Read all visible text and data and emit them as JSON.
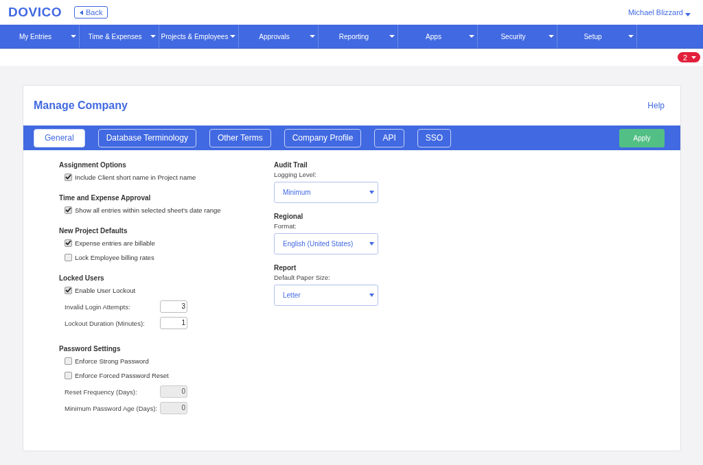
{
  "header": {
    "logo": "DOVICO",
    "back_button": "Back",
    "user": "Michael Blizzard"
  },
  "nav": [
    {
      "label": "My Entries"
    },
    {
      "label": "Time & Expenses"
    },
    {
      "label": "Projects & Employees"
    },
    {
      "label": "Approvals"
    },
    {
      "label": "Reporting"
    },
    {
      "label": "Apps"
    },
    {
      "label": "Security"
    },
    {
      "label": "Setup"
    }
  ],
  "notification_badge": "2",
  "page": {
    "title": "Manage Company",
    "help": "Help"
  },
  "tabs": [
    {
      "label": "General",
      "selected": true
    },
    {
      "label": "Database Terminology",
      "selected": false
    },
    {
      "label": "Other Terms",
      "selected": false
    },
    {
      "label": "Company Profile",
      "selected": false
    },
    {
      "label": "API",
      "selected": false
    },
    {
      "label": "SSO",
      "selected": false
    }
  ],
  "apply_button": "Apply",
  "left_sections": [
    {
      "title": "Assignment Options",
      "items": [
        {
          "kind": "checkbox",
          "label": "Include Client short name in Project name",
          "checked": true
        }
      ]
    },
    {
      "title": "Time and Expense Approval",
      "items": [
        {
          "kind": "checkbox",
          "label": "Show all entries within selected sheet's date range",
          "checked": true
        }
      ]
    },
    {
      "title": "New Project Defaults",
      "items": [
        {
          "kind": "checkbox",
          "label": "Expense entries are billable",
          "checked": true
        },
        {
          "kind": "checkbox",
          "label": "Lock Employee billing rates",
          "checked": false
        }
      ]
    },
    {
      "title": "Locked Users",
      "items": [
        {
          "kind": "checkbox",
          "label": "Enable User Lockout",
          "checked": true
        },
        {
          "kind": "number",
          "label": "Invalid Login Attempts:",
          "value": "3",
          "disabled": false
        },
        {
          "kind": "number",
          "label": "Lockout Duration (Minutes):",
          "value": "1",
          "disabled": false
        }
      ]
    },
    {
      "title": "Password Settings",
      "items": [
        {
          "kind": "checkbox",
          "label": "Enforce Strong Password",
          "checked": false
        },
        {
          "kind": "checkbox",
          "label": "Enforce Forced Password Reset",
          "checked": false
        },
        {
          "kind": "number",
          "label": "Reset Frequency (Days):",
          "value": "0",
          "disabled": true
        },
        {
          "kind": "number",
          "label": "Minimum Password Age (Days):",
          "value": "0",
          "disabled": true
        }
      ]
    }
  ],
  "right_sections": [
    {
      "title": "Audit Trail",
      "label": "Logging Level:",
      "value": "Minimum"
    },
    {
      "title": "Regional",
      "label": "Format:",
      "value": "English (United States)"
    },
    {
      "title": "Report",
      "label": "Default Paper Size:",
      "value": "Letter"
    }
  ]
}
